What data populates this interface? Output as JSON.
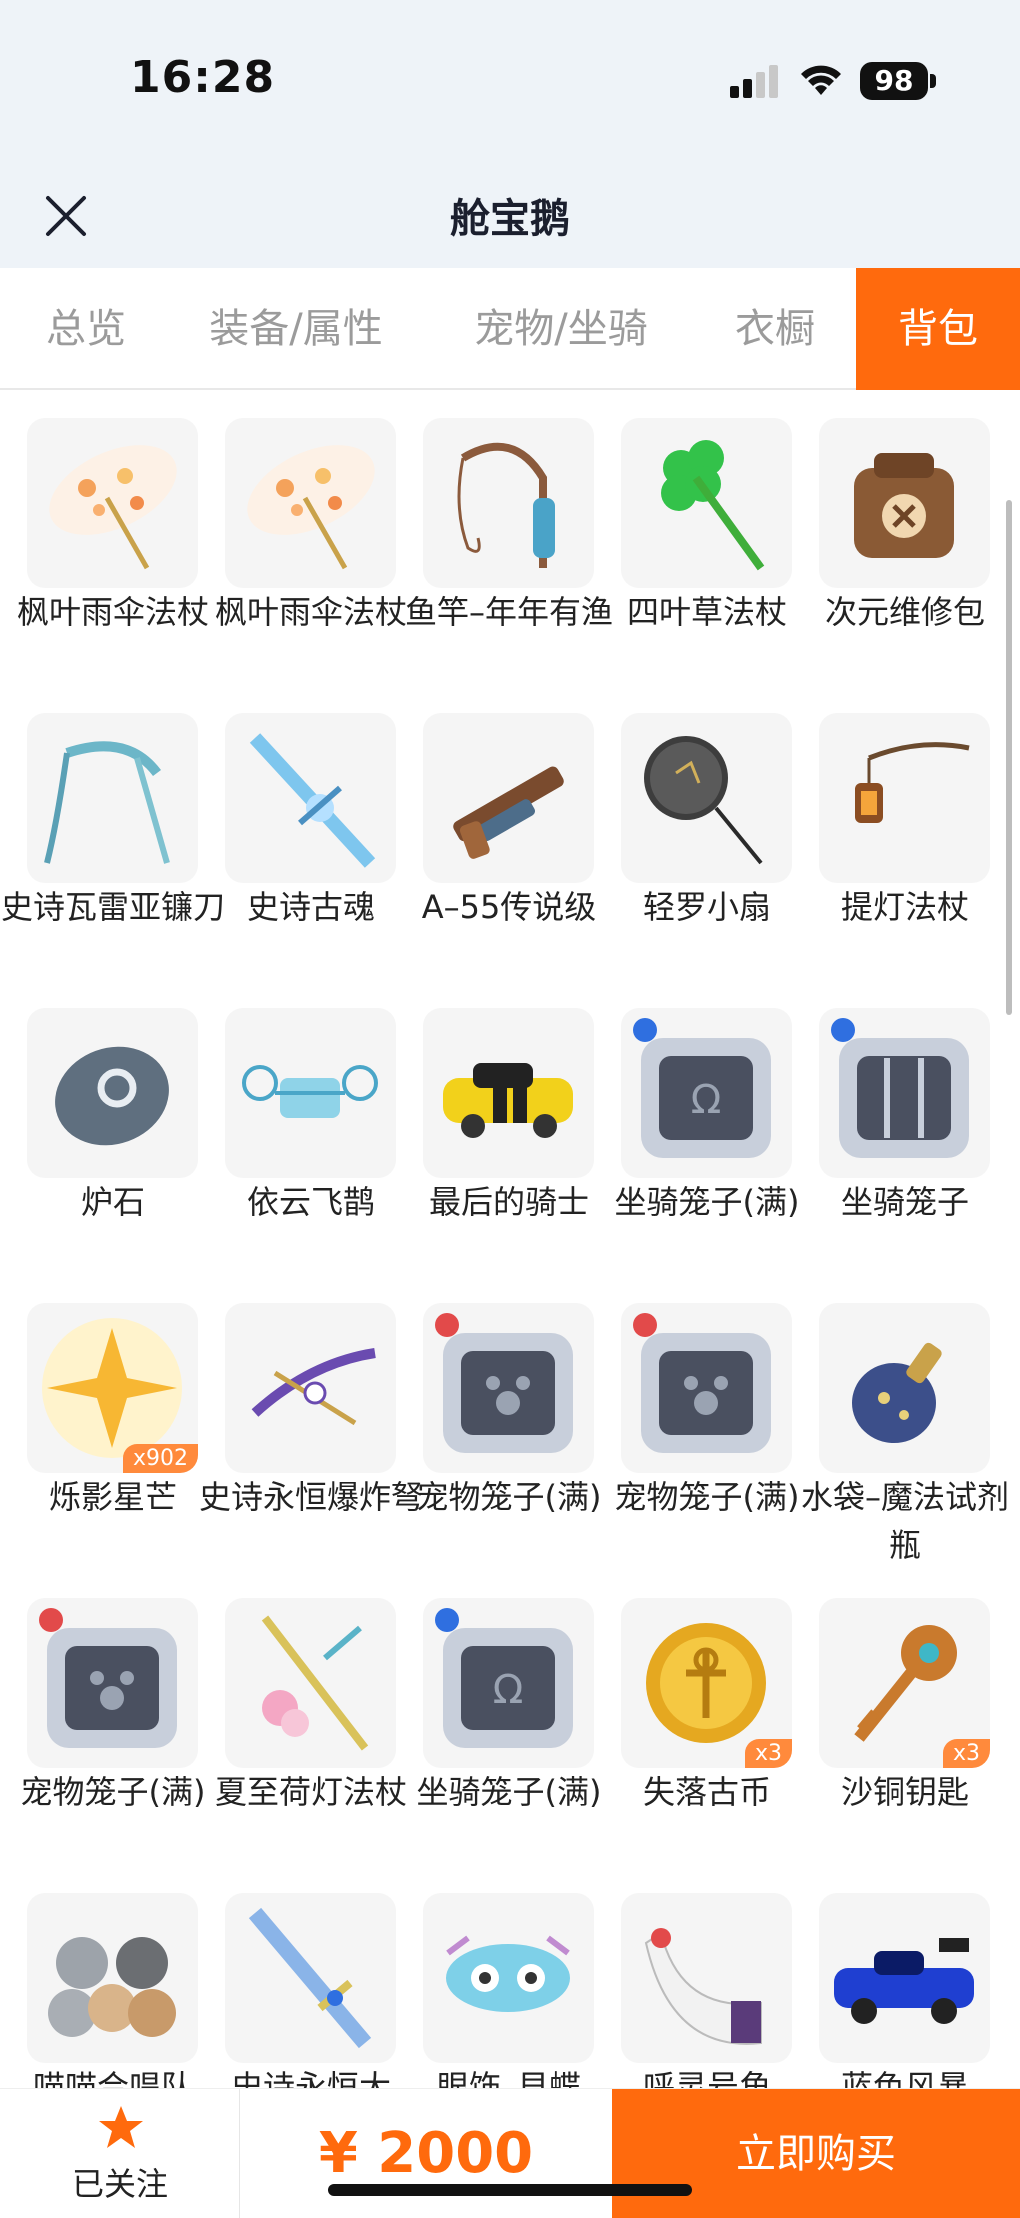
{
  "status": {
    "time": "16:28",
    "battery": "98"
  },
  "nav": {
    "title": "舱宝鹅"
  },
  "tabs": [
    "总览",
    "装备/属性",
    "宠物/坐骑",
    "衣橱",
    "背包"
  ],
  "active_tab": "背包",
  "items": [
    {
      "name": "枫叶雨伞法杖",
      "icon": "maple-umbrella-icon",
      "badge": ""
    },
    {
      "name": "枫叶雨伞法杖",
      "icon": "maple-umbrella-icon",
      "badge": ""
    },
    {
      "name": "鱼竿–年年有渔",
      "icon": "fishing-rod-icon",
      "badge": ""
    },
    {
      "name": "四叶草法杖",
      "icon": "clover-staff-icon",
      "badge": ""
    },
    {
      "name": "次元维修包",
      "icon": "repair-bag-icon",
      "badge": ""
    },
    {
      "name": "史诗瓦雷亚镰刀",
      "icon": "scythe-icon",
      "badge": ""
    },
    {
      "name": "史诗古魂",
      "icon": "ancient-sword-icon",
      "badge": ""
    },
    {
      "name": "A–55传说级",
      "icon": "rifle-icon",
      "badge": ""
    },
    {
      "name": "轻罗小扇",
      "icon": "round-fan-icon",
      "badge": ""
    },
    {
      "name": "提灯法杖",
      "icon": "lantern-staff-icon",
      "badge": ""
    },
    {
      "name": "炉石",
      "icon": "hearthstone-icon",
      "badge": ""
    },
    {
      "name": "依云飞鹊",
      "icon": "drone-icon",
      "badge": ""
    },
    {
      "name": "最后的骑士",
      "icon": "yellow-car-icon",
      "badge": ""
    },
    {
      "name": "坐骑笼子(满)",
      "icon": "mount-cage-icon",
      "badge": ""
    },
    {
      "name": "坐骑笼子",
      "icon": "mount-cage-empty-icon",
      "badge": ""
    },
    {
      "name": "烁影星芒",
      "icon": "star-sparkle-icon",
      "badge": "x902"
    },
    {
      "name": "史诗永恒爆炸弩",
      "icon": "crossbow-icon",
      "badge": ""
    },
    {
      "name": "宠物笼子(满)",
      "icon": "pet-cage-icon",
      "badge": ""
    },
    {
      "name": "宠物笼子(满)",
      "icon": "pet-cage-icon",
      "badge": ""
    },
    {
      "name": "水袋–魔法试剂瓶",
      "icon": "potion-bottle-icon",
      "badge": ""
    },
    {
      "name": "宠物笼子(满)",
      "icon": "pet-cage-icon",
      "badge": ""
    },
    {
      "name": "夏至荷灯法杖",
      "icon": "lotus-staff-icon",
      "badge": ""
    },
    {
      "name": "坐骑笼子(满)",
      "icon": "mount-cage-icon",
      "badge": ""
    },
    {
      "name": "失落古币",
      "icon": "ancient-coin-icon",
      "badge": "x3"
    },
    {
      "name": "沙铜钥匙",
      "icon": "bronze-key-icon",
      "badge": "x3"
    },
    {
      "name": "喵喵合唱队",
      "icon": "cat-choir-icon",
      "badge": ""
    },
    {
      "name": "史诗永恒大",
      "icon": "great-sword-icon",
      "badge": ""
    },
    {
      "name": "眼饰–貝蝶",
      "icon": "eye-mask-icon",
      "badge": ""
    },
    {
      "name": "呼灵号角",
      "icon": "horn-icon",
      "badge": ""
    },
    {
      "name": "蓝色风暴",
      "icon": "blue-racecar-icon",
      "badge": ""
    }
  ],
  "bottom": {
    "follow_label": "已关注",
    "price": "¥ 2000",
    "buy_label": "立即购买"
  },
  "colors": {
    "accent": "#ff6a0d",
    "header_bg": "#eef3f8"
  }
}
